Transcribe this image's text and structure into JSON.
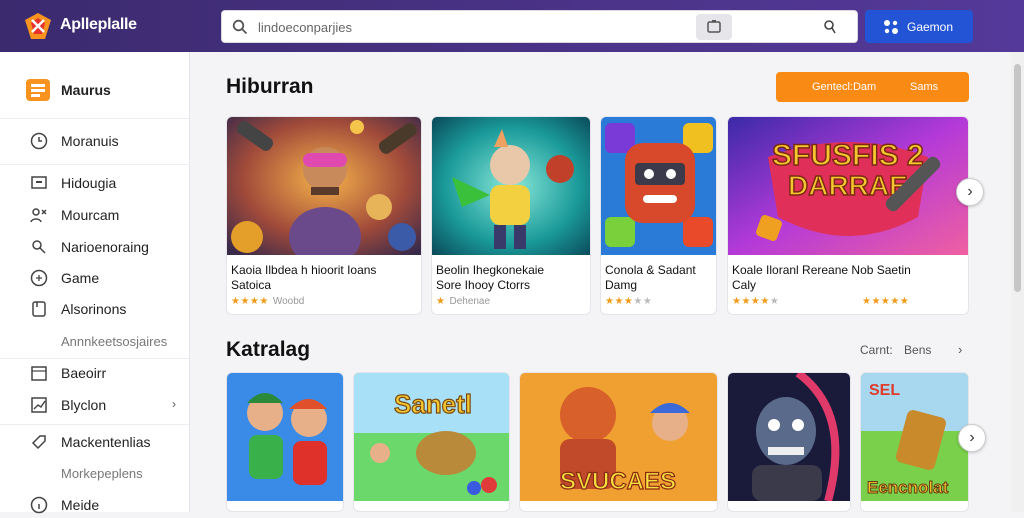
{
  "header": {
    "app_name": "Aplleplalle",
    "search_placeholder": "lindoeconparjies",
    "signin_label": "Gaemon",
    "brand_color": "#4a3387",
    "accent_color": "#2454d6"
  },
  "sidebar": {
    "items": [
      {
        "label": "Maurus",
        "icon": "apps-icon"
      },
      {
        "label": "Moranuis",
        "icon": "clock-icon"
      },
      {
        "label": "Hidougia",
        "icon": "tv-icon"
      },
      {
        "label": "Mourcam",
        "icon": "people-icon"
      },
      {
        "label": "Narioenoraing",
        "icon": "puzzle-icon"
      },
      {
        "label": "Game",
        "icon": "gamepad-icon"
      },
      {
        "label": "Alsorinons",
        "icon": "bookmark-icon"
      },
      {
        "label": "Annnkeetsosjaires",
        "icon": ""
      },
      {
        "label": "Baeoirr",
        "icon": "calendar-icon"
      },
      {
        "label": "Blyclon",
        "icon": "chart-icon"
      },
      {
        "label": "Mackentenlias",
        "icon": "tag-icon"
      },
      {
        "label": "Morkepeplens",
        "icon": ""
      },
      {
        "label": "Meide",
        "icon": "info-icon"
      }
    ]
  },
  "section1": {
    "title": "Hiburran",
    "btn_a": "Gentecl:Dam",
    "btn_b": "Sams",
    "cards": [
      {
        "name": "Kaoia Ilbdea h hioorit Ioans",
        "sub": "Satoica",
        "stars": 4,
        "meta": "Woobd"
      },
      {
        "name": "Beolin Ihegkonekaie",
        "sub": "Sore Ihooy Ctorrs",
        "stars": 1,
        "meta": "Dehenae"
      },
      {
        "name": "Conola & Sadant",
        "sub": "Damg",
        "stars": 3,
        "meta": ""
      },
      {
        "name": "Koale Iloranl Rereane Nob Saetin",
        "sub": "Caly",
        "stars": 4,
        "meta": ""
      }
    ],
    "badge_stars": 5
  },
  "section2": {
    "title": "Katralag",
    "see_a": "Carnt:",
    "see_b": "Bens"
  },
  "colors": {
    "orange": "#f98a14",
    "star": "#f29b1a"
  }
}
